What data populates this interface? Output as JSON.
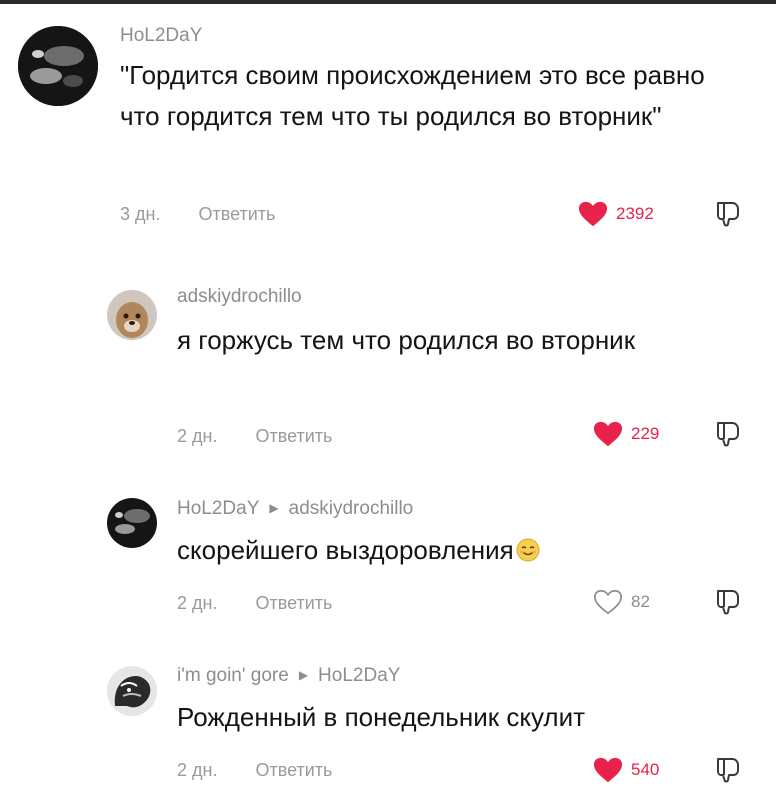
{
  "comments": [
    {
      "user": "HoL2DaY",
      "reply_to": "",
      "text": "\"Гордится своим происхождением это все равно что гордится тем что ты родился во вторник\"",
      "age": "3 дн.",
      "reply_label": "Ответить",
      "likes": "2392",
      "liked": true
    },
    {
      "user": "adskiydrochillo",
      "reply_to": "",
      "text": "я горжусь тем что родился во вторник",
      "age": "2 дн.",
      "reply_label": "Ответить",
      "likes": "229",
      "liked": true
    },
    {
      "user": "HoL2DaY",
      "reply_to": "adskiydrochillo",
      "text": "скорейшего выздоровления",
      "emoji": "smiling-face-emoji",
      "age": "2 дн.",
      "reply_label": "Ответить",
      "likes": "82",
      "liked": false
    },
    {
      "user": "i'm goin' gore",
      "reply_to": "HoL2DaY",
      "text": "Рожденный в понедельник скулит",
      "age": "2 дн.",
      "reply_label": "Ответить",
      "likes": "540",
      "liked": true
    }
  ],
  "colors": {
    "like_red": "#e8224a",
    "meta_grey": "#9a9a9a",
    "text": "#141414"
  },
  "icons": {
    "like": "heart-icon",
    "dislike": "dislike-icon",
    "reply_arrow": "reply-arrow-icon"
  }
}
